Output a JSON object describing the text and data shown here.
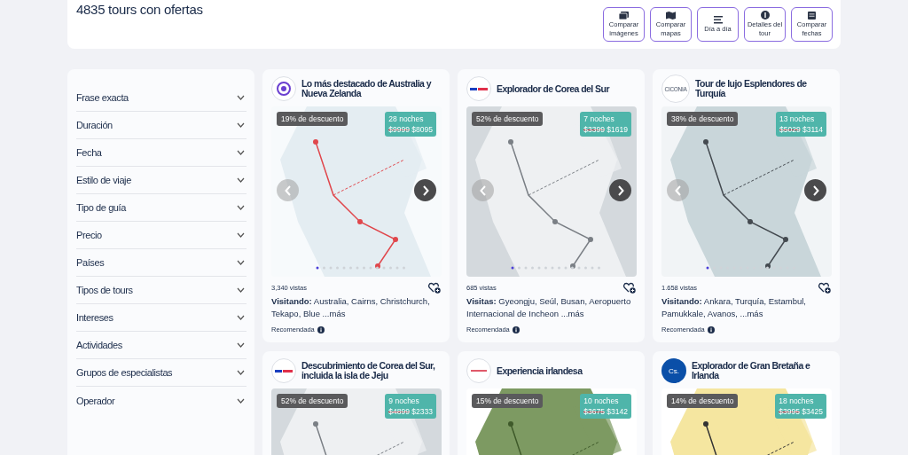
{
  "header": {
    "title": "4835 tours con ofertas",
    "buttons": [
      {
        "kind": "images",
        "label": "Comparar imágenes"
      },
      {
        "kind": "map",
        "label": "Comparar mapas"
      },
      {
        "kind": "list",
        "label": "Día a día"
      },
      {
        "kind": "dollar",
        "label": "Detalles del tour"
      },
      {
        "kind": "calendar",
        "label": "Comparar fechas"
      }
    ]
  },
  "filters": [
    {
      "label": "Frase exacta",
      "expanded": false
    },
    {
      "label": "Duración",
      "expanded": false
    },
    {
      "label": "Fecha",
      "expanded": false
    },
    {
      "label": "Estilo de viaje",
      "expanded": false
    },
    {
      "label": "Tipo de guía",
      "expanded": false
    },
    {
      "label": "Precio",
      "expanded": false
    },
    {
      "label": "Países",
      "expanded": false
    },
    {
      "label": "Tipos de tours",
      "expanded": false
    },
    {
      "label": "Intereses",
      "expanded": false
    },
    {
      "label": "Actividades",
      "expanded": false
    },
    {
      "label": "Grupos de especialistas",
      "expanded": false
    },
    {
      "label": "Operador",
      "expanded": false
    }
  ],
  "tours": [
    {
      "logo": {
        "kind": "mark",
        "color": "#6a3fd0"
      },
      "title": "Lo más destacado de Australia y Nueva Zelanda",
      "discount": "19% de descuento",
      "nights": "28 noches",
      "old_price": "$9999",
      "price": "$8095",
      "prev_disabled": true,
      "views": "3,340 vistas",
      "visiting": "**Visitando:** Australia, Cairns, Christchurch, Tekapo, Blue ...más",
      "recommended": "Recomendada"
    },
    {
      "logo": {
        "kind": "bars",
        "color": "#e0304a"
      },
      "title": "Explorador de Corea del Sur",
      "discount": "52% de descuento",
      "nights": "7 noches",
      "old_price": "$3399",
      "price": "$1619",
      "prev_disabled": true,
      "views": "685 vistas",
      "visiting": "**Visitas:** Gyeongju, Seúl, Busan, Aeropuerto Internacional de Incheon ...más",
      "recommended": "Recomendada"
    },
    {
      "logo": {
        "kind": "text",
        "text": "CICONIA"
      },
      "title": "Tour de lujo Esplendores de Turquía",
      "discount": "38% de descuento",
      "nights": "13 noches",
      "old_price": "$5029",
      "price": "$3114",
      "prev_disabled": true,
      "views": "1.658 vistas",
      "visiting": "**Visitando:** Ankara, Turquía, Estambul, Pamukkale, Avanos, ...más",
      "recommended": "Recomendada"
    },
    {
      "logo": {
        "kind": "bars",
        "color": "#e0304a"
      },
      "title": "Descubrimiento de Corea del Sur, incluida la isla de Jeju",
      "discount": "52% de descuento",
      "nights": "9 noches",
      "old_price": "$4899",
      "price": "$2333"
    },
    {
      "logo": {
        "kind": "line",
        "color": "#e05a6a"
      },
      "title": "Experiencia irlandesa",
      "discount": "15% de descuento",
      "nights": "10 noches",
      "old_price": "$3675",
      "price": "$3142"
    },
    {
      "logo": {
        "kind": "filled",
        "text": "Cs.",
        "color": "#0a4fa8"
      },
      "title": "Explorador de Gran Bretaña e Irlanda",
      "discount": "14% de descuento",
      "nights": "18 noches",
      "old_price": "$3995",
      "price": "$3425"
    }
  ]
}
